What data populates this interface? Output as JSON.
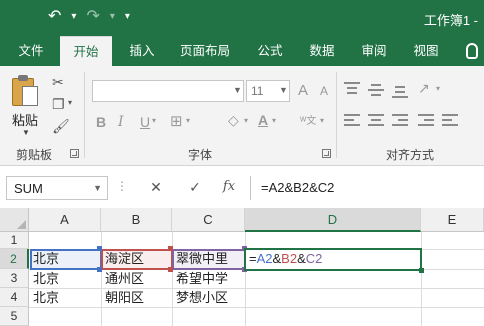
{
  "window": {
    "title": "工作簿1 -",
    "icons": [
      "undo-icon",
      "redo-icon",
      "customize-qat-icon"
    ],
    "accent_color": "#217346"
  },
  "tabs": [
    {
      "label": "文件",
      "active": false
    },
    {
      "label": "开始",
      "active": true
    },
    {
      "label": "插入",
      "active": false
    },
    {
      "label": "页面布局",
      "active": false
    },
    {
      "label": "公式",
      "active": false
    },
    {
      "label": "数据",
      "active": false
    },
    {
      "label": "审阅",
      "active": false
    },
    {
      "label": "视图",
      "active": false
    }
  ],
  "ribbon": {
    "clipboard": {
      "paste_label": "粘贴",
      "group_label": "剪贴板"
    },
    "font": {
      "font_name": "",
      "font_size": "11",
      "group_label": "字体"
    },
    "alignment": {
      "group_label": "对齐方式"
    }
  },
  "formula_bar": {
    "name_box": "SUM",
    "cancel_symbol": "✕",
    "enter_symbol": "✓",
    "fx_label": "fx",
    "formula": "=A2&B2&C2"
  },
  "sheet": {
    "columns": [
      "A",
      "B",
      "C",
      "D",
      "E"
    ],
    "selected_column": "D",
    "rows": [
      "1",
      "2",
      "3",
      "4",
      "5"
    ],
    "selected_row": "2",
    "cells": {
      "A2": "北京",
      "B2": "海淀区",
      "C2": "翠微中里",
      "A3": "北京",
      "B3": "通州区",
      "C3": "希望中学",
      "A4": "北京",
      "B4": "朝阳区",
      "C4": "梦想小区"
    },
    "editing_formula_parts": {
      "eq": "=",
      "a": "A2",
      "amp1": "&",
      "b": "B2",
      "amp2": "&",
      "c": "C2"
    },
    "reference_colors": {
      "A2": "#4472c4",
      "B2": "#c0504d",
      "C2": "#8064a2"
    }
  }
}
